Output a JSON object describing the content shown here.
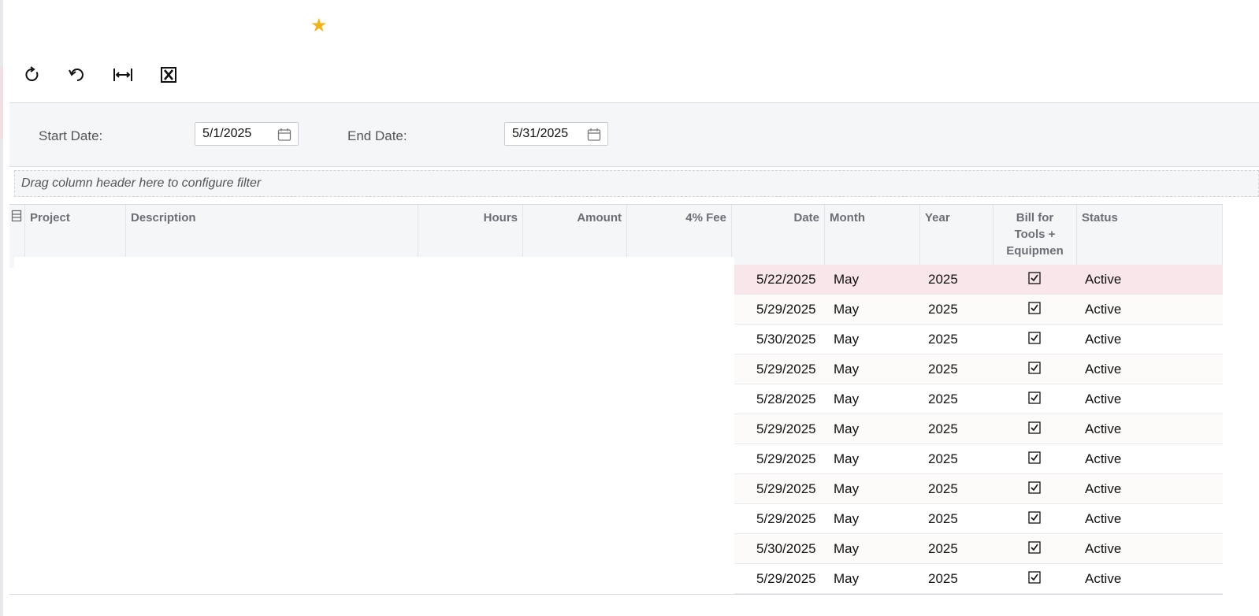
{
  "toolbar": {
    "refresh_icon": "refresh-icon",
    "undo_icon": "undo-icon",
    "fit_icon": "fit-columns-icon",
    "excel_icon": "excel-export-icon",
    "favorite_icon": "star-icon",
    "accent_color": "#f2b417"
  },
  "filters": {
    "start_label": "Start Date:",
    "start_value": "5/1/2025",
    "end_label": "End Date:",
    "end_value": "5/31/2025"
  },
  "drag_zone": {
    "text": "Drag column header here to configure filter"
  },
  "columns": {
    "project": "Project",
    "description": "Description",
    "hours": "Hours",
    "amount": "Amount",
    "fee": "4% Fee",
    "date": "Date",
    "month": "Month",
    "year": "Year",
    "bill_line1": "Bill for",
    "bill_line2": "Tools +",
    "bill_line3": "Equipmen",
    "status": "Status"
  },
  "rows": [
    {
      "date": "5/22/2025",
      "month": "May",
      "year": "2025",
      "bill": true,
      "status": "Active"
    },
    {
      "date": "5/29/2025",
      "month": "May",
      "year": "2025",
      "bill": true,
      "status": "Active"
    },
    {
      "date": "5/30/2025",
      "month": "May",
      "year": "2025",
      "bill": true,
      "status": "Active"
    },
    {
      "date": "5/29/2025",
      "month": "May",
      "year": "2025",
      "bill": true,
      "status": "Active"
    },
    {
      "date": "5/28/2025",
      "month": "May",
      "year": "2025",
      "bill": true,
      "status": "Active"
    },
    {
      "date": "5/29/2025",
      "month": "May",
      "year": "2025",
      "bill": true,
      "status": "Active"
    },
    {
      "date": "5/29/2025",
      "month": "May",
      "year": "2025",
      "bill": true,
      "status": "Active"
    },
    {
      "date": "5/29/2025",
      "month": "May",
      "year": "2025",
      "bill": true,
      "status": "Active"
    },
    {
      "date": "5/29/2025",
      "month": "May",
      "year": "2025",
      "bill": true,
      "status": "Active"
    },
    {
      "date": "5/30/2025",
      "month": "May",
      "year": "2025",
      "bill": true,
      "status": "Active"
    },
    {
      "date": "5/29/2025",
      "month": "May",
      "year": "2025",
      "bill": true,
      "status": "Active"
    }
  ]
}
